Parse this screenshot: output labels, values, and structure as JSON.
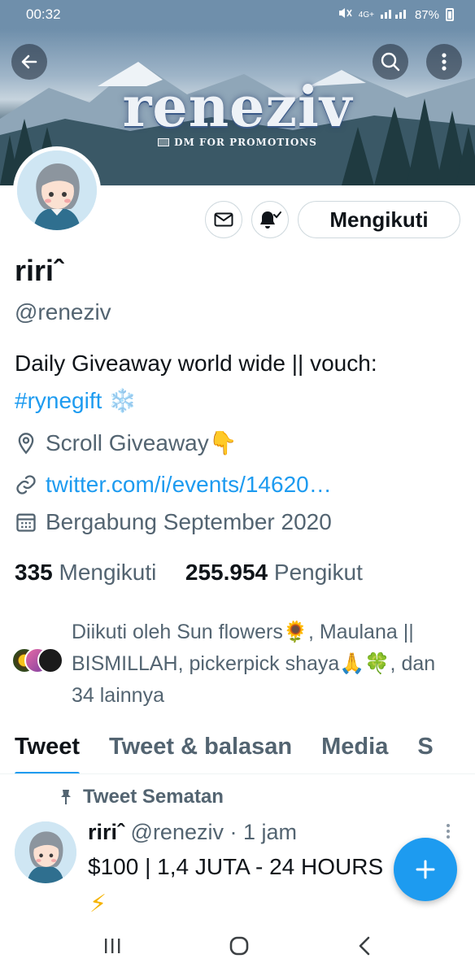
{
  "status_bar": {
    "time": "00:32",
    "network": "4G+",
    "battery": "87%"
  },
  "banner": {
    "title": "reneziv",
    "subtitle": "DM FOR PROMOTIONS"
  },
  "header_icons": {
    "back": "arrow-left-icon",
    "search": "search-icon",
    "more": "more-vertical-icon"
  },
  "actions": {
    "message": "mail-icon",
    "notify": "bell-check-icon",
    "follow_label": "Mengikuti"
  },
  "profile": {
    "name": "ririˆ",
    "handle": "@reneziv",
    "bio_text": "Daily Giveaway world wide || vouch:",
    "bio_hashtag": "#rynegift",
    "bio_emoji": "❄️",
    "location": "Scroll Giveaway👇",
    "url": "twitter.com/i/events/14620…",
    "joined": "Bergabung September 2020"
  },
  "stats": {
    "following_count": "335",
    "following_label": "Mengikuti",
    "followers_count": "255.954",
    "followers_label": "Pengikut"
  },
  "followed_by": {
    "text": "Diikuti oleh Sun flowers🌻, Maulana || BISMILLAH, pickerpick shaya🙏🍀, dan 34 lainnya"
  },
  "tabs": [
    {
      "label": "Tweet",
      "active": true
    },
    {
      "label": "Tweet & balasan",
      "active": false
    },
    {
      "label": "Media",
      "active": false
    },
    {
      "label": "S",
      "active": false
    }
  ],
  "pinned_tweet": {
    "pinned_label": "Tweet Sematan",
    "name": "ririˆ",
    "handle": "@reneziv",
    "time": "· 1 jam",
    "text": "$100 | 1,4 JUTA - 24 HOURS",
    "emoji": "⚡"
  },
  "fab": {
    "icon": "plus-icon"
  },
  "colors": {
    "accent": "#1d9bf0",
    "text_primary": "#0f1419",
    "text_secondary": "#536471",
    "border": "#cfd9de"
  }
}
